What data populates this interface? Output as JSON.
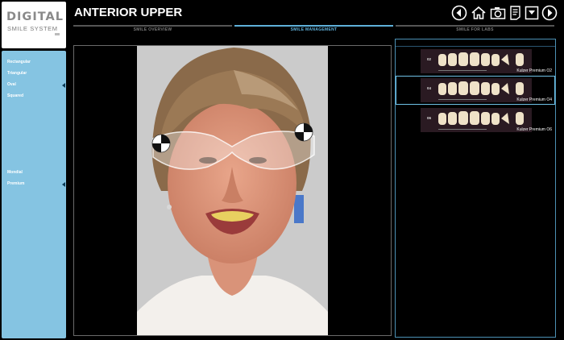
{
  "logo": {
    "line1": "DIGITAL",
    "line2": "SMILE SYSTEM"
  },
  "title": "ANTERIOR UPPER",
  "tabs": [
    {
      "label": "SMILE OVERVIEW",
      "active": false
    },
    {
      "label": "SMILE MANAGEMENT",
      "active": true
    },
    {
      "label": "SMILE FOR LABS",
      "active": false
    }
  ],
  "toolbar": [
    "back-icon",
    "home-icon",
    "camera-icon",
    "notes-icon",
    "export-icon",
    "forward-icon"
  ],
  "sidebar": {
    "items": [
      {
        "label": "Rectangular",
        "expanded": false
      },
      {
        "label": "Triangular",
        "expanded": false
      },
      {
        "label": "Oval",
        "expanded": true
      },
      {
        "label": "Squared",
        "expanded": false
      },
      {
        "label": "Mondial",
        "expanded": false
      },
      {
        "label": "Premium",
        "expanded": true
      }
    ]
  },
  "library": {
    "items": [
      {
        "code": "02",
        "name": "Kulzer Premium O2",
        "scale": "",
        "selected": false
      },
      {
        "code": "04",
        "name": "Kulzer Premium O4",
        "scale": "",
        "selected": true
      },
      {
        "code": "06",
        "name": "Kulzer Premium O6",
        "scale": "",
        "selected": false
      }
    ]
  },
  "colors": {
    "accent": "#5fb0d9",
    "sidebar": "#85c4e2",
    "background": "#000000"
  }
}
